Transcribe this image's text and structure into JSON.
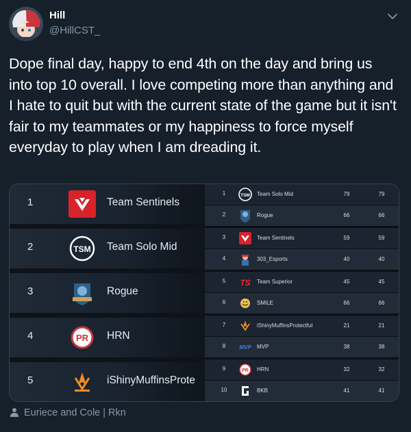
{
  "tweet": {
    "author_name": "Hill",
    "handle": "@HillCST_",
    "text": "Dope final day, happy to end 4th on the day and bring us into top 10 overall. I love competing more than anything and I hate to quit but with the current state of the game but it isn't fair to my teammates or my happiness to force myself everyday to play when I am dreading it."
  },
  "media": {
    "left_standings": [
      {
        "rank": "1",
        "team": "Team Sentinels",
        "logo": "sentinels-logo"
      },
      {
        "rank": "2",
        "team": "Team Solo Mid",
        "logo": "tsm-logo"
      },
      {
        "rank": "3",
        "team": "Rogue",
        "logo": "rogue-logo"
      },
      {
        "rank": "4",
        "team": "HRN",
        "logo": "hrn-logo"
      },
      {
        "rank": "5",
        "team": "iShinyMuffinsProte",
        "logo": "fnatic-logo"
      }
    ],
    "right_standings": [
      {
        "rank": "1",
        "team": "Team Solo Mid",
        "v1": "79",
        "v2": "79",
        "logo": "tsm-logo"
      },
      {
        "rank": "2",
        "team": "Rogue",
        "v1": "66",
        "v2": "66",
        "logo": "rogue-logo"
      },
      {
        "rank": "3",
        "team": "Team Sentinels",
        "v1": "59",
        "v2": "59",
        "logo": "sentinels-logo"
      },
      {
        "rank": "4",
        "team": "303_Esports",
        "v1": "40",
        "v2": "40",
        "logo": "303-logo"
      },
      {
        "rank": "5",
        "team": "Team Superior",
        "v1": "45",
        "v2": "45",
        "logo": "superior-logo"
      },
      {
        "rank": "6",
        "team": "SMILE",
        "v1": "66",
        "v2": "66",
        "logo": "smile-logo"
      },
      {
        "rank": "7",
        "team": "iShinyMuffinsProtectful",
        "v1": "21",
        "v2": "21",
        "logo": "fnatic-logo"
      },
      {
        "rank": "8",
        "team": "MVP",
        "v1": "38",
        "v2": "38",
        "logo": "mvp-logo"
      },
      {
        "rank": "9",
        "team": "HRN",
        "v1": "32",
        "v2": "32",
        "logo": "hrn-logo"
      },
      {
        "rank": "10",
        "team": "BKB",
        "v1": "41",
        "v2": "41",
        "logo": "bkb-logo"
      }
    ]
  },
  "footer": {
    "tagged": "Euriece and Cole | Rkn",
    "icon": "person-icon"
  },
  "colors": {
    "background": "#15202b",
    "secondary_text": "#8899a6",
    "sentinels_red": "#d8232a"
  }
}
